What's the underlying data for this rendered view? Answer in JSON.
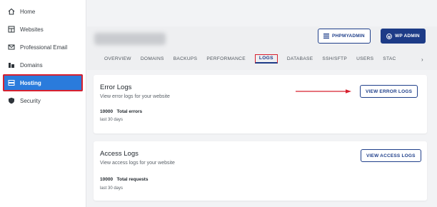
{
  "sidebar": {
    "items": [
      {
        "label": "Home",
        "icon": "home-icon"
      },
      {
        "label": "Websites",
        "icon": "websites-icon"
      },
      {
        "label": "Professional Email",
        "icon": "email-icon"
      },
      {
        "label": "Domains",
        "icon": "domains-icon"
      },
      {
        "label": "Hosting",
        "icon": "hosting-icon",
        "active": true
      },
      {
        "label": "Security",
        "icon": "shield-icon"
      }
    ]
  },
  "header": {
    "phpmyadmin_label": "PHPMYADMIN",
    "wpadmin_label": "WP ADMIN",
    "tabs": [
      {
        "label": "OVERVIEW"
      },
      {
        "label": "DOMAINS"
      },
      {
        "label": "BACKUPS"
      },
      {
        "label": "PERFORMANCE"
      },
      {
        "label": "LOGS",
        "active": true
      },
      {
        "label": "DATABASE"
      },
      {
        "label": "SSH/SFTP"
      },
      {
        "label": "USERS"
      },
      {
        "label": "STAC"
      }
    ],
    "more_label": "›"
  },
  "error_logs": {
    "title": "Error Logs",
    "description": "View error logs for your website",
    "count": "10000",
    "count_label": "Total errors",
    "period": "last 30 days",
    "button_label": "VIEW ERROR LOGS"
  },
  "access_logs": {
    "title": "Access Logs",
    "description": "View access logs for your website",
    "count": "10000",
    "count_label": "Total requests",
    "period": "last 30 days",
    "button_label": "VIEW ACCESS LOGS"
  },
  "colors": {
    "accent": "#1d3b87",
    "active_nav": "#2a7bdc",
    "highlight": "#d7202f"
  }
}
